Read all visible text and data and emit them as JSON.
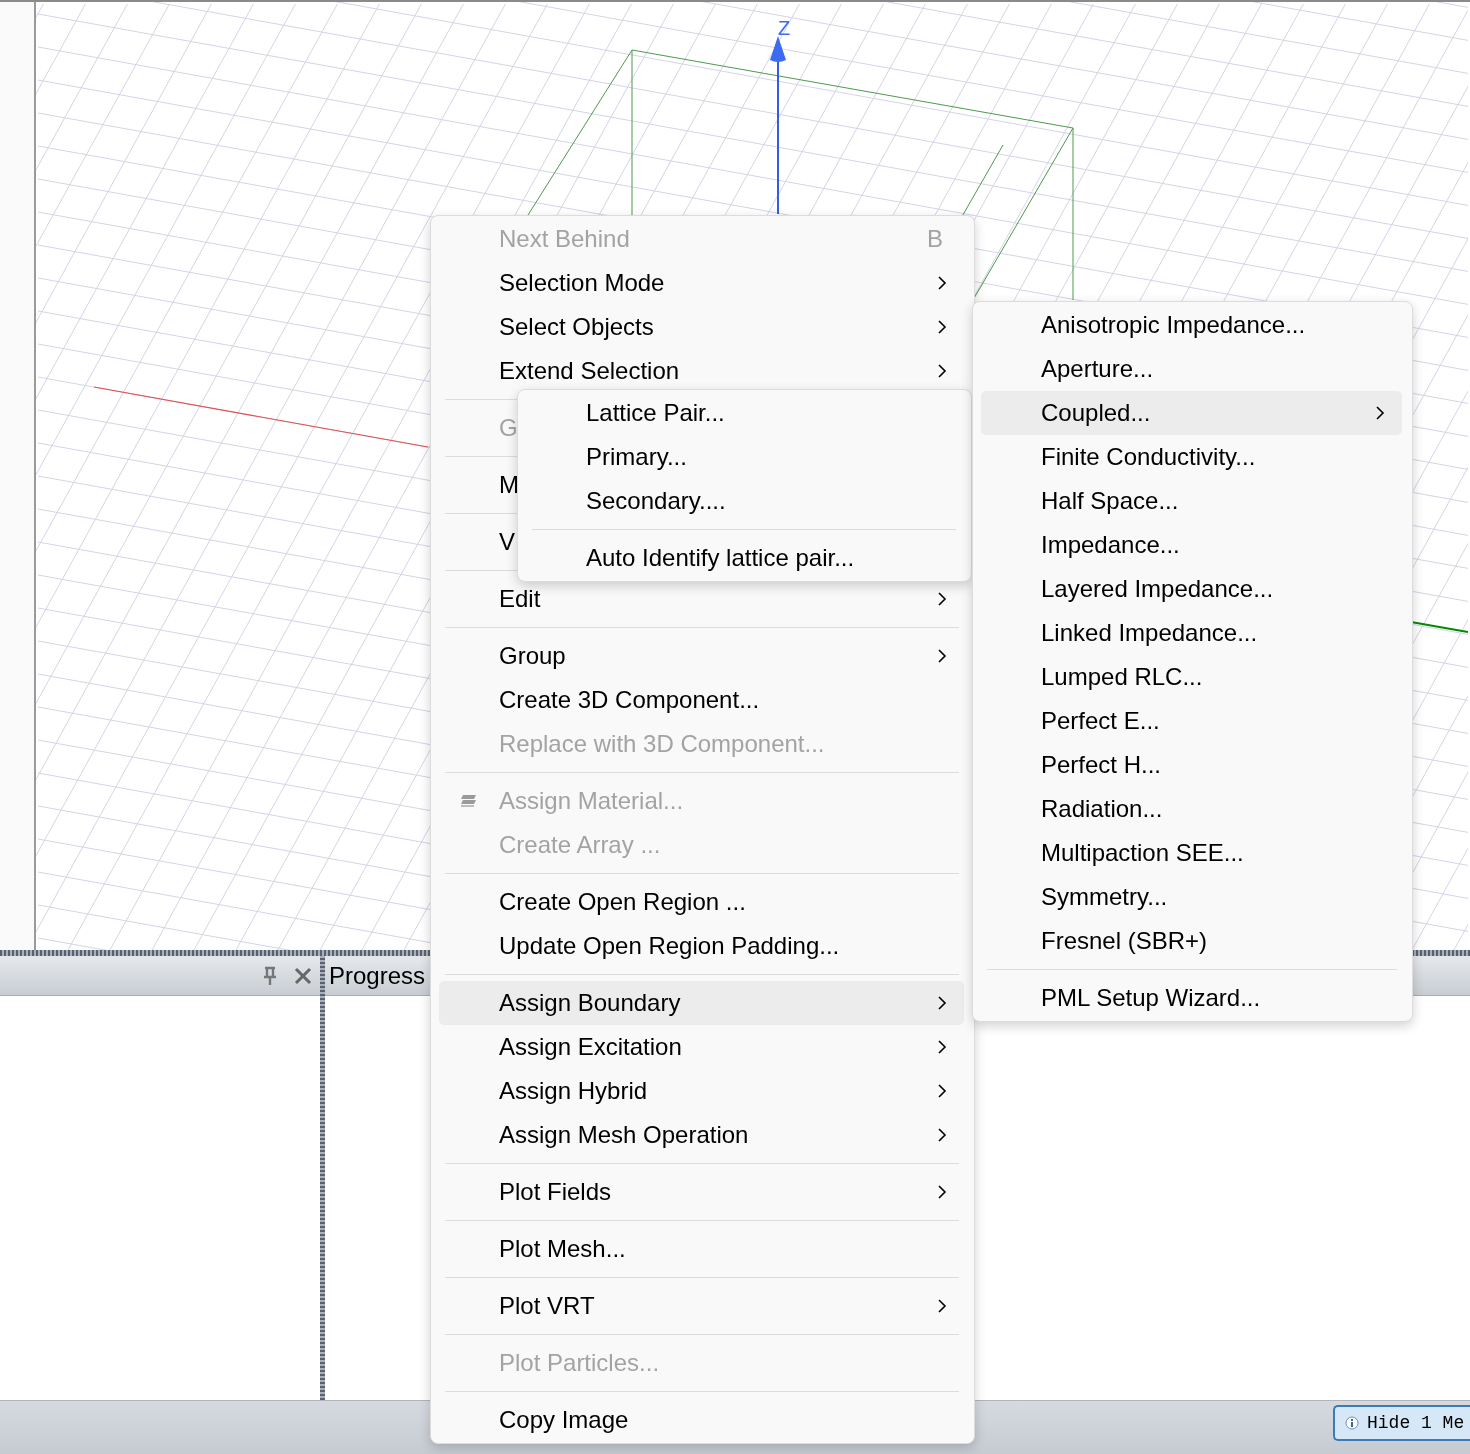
{
  "viewport": {
    "axis_label": "Z"
  },
  "progress_panel": {
    "title": "Progress"
  },
  "status_bar": {
    "message_button": "Hide 1 Me"
  },
  "context_menu": {
    "items": [
      {
        "kind": "item",
        "label": "Next Behind",
        "shortcut": "B",
        "disabled": true,
        "submenu": false,
        "selected": false
      },
      {
        "kind": "item",
        "label": "Selection Mode",
        "disabled": false,
        "submenu": true,
        "selected": false
      },
      {
        "kind": "item",
        "label": "Select Objects",
        "disabled": false,
        "submenu": true,
        "selected": false
      },
      {
        "kind": "item",
        "label": "Extend Selection",
        "disabled": false,
        "submenu": true,
        "selected": false
      },
      {
        "kind": "separator"
      },
      {
        "kind": "item",
        "label": "G",
        "disabled": true,
        "submenu": false,
        "selected": false
      },
      {
        "kind": "separator"
      },
      {
        "kind": "item",
        "label": "M",
        "disabled": false,
        "submenu": false,
        "selected": false
      },
      {
        "kind": "separator"
      },
      {
        "kind": "item",
        "label": "V",
        "disabled": false,
        "submenu": false,
        "selected": false
      },
      {
        "kind": "separator"
      },
      {
        "kind": "item",
        "label": "Edit",
        "disabled": false,
        "submenu": true,
        "selected": false
      },
      {
        "kind": "separator"
      },
      {
        "kind": "item",
        "label": "Group",
        "disabled": false,
        "submenu": true,
        "selected": false
      },
      {
        "kind": "item",
        "label": "Create 3D Component...",
        "disabled": false,
        "submenu": false,
        "selected": false
      },
      {
        "kind": "item",
        "label": "Replace with 3D Component...",
        "disabled": true,
        "submenu": false,
        "selected": false
      },
      {
        "kind": "separator"
      },
      {
        "kind": "icon-item",
        "label": "Assign Material...",
        "disabled": true,
        "submenu": false,
        "selected": false
      },
      {
        "kind": "item",
        "label": "Create Array ...",
        "disabled": true,
        "submenu": false,
        "selected": false
      },
      {
        "kind": "separator"
      },
      {
        "kind": "item",
        "label": "Create Open Region ...",
        "disabled": false,
        "submenu": false,
        "selected": false
      },
      {
        "kind": "item",
        "label": "Update Open Region Padding...",
        "disabled": false,
        "submenu": false,
        "selected": false
      },
      {
        "kind": "separator"
      },
      {
        "kind": "item",
        "label": "Assign Boundary",
        "disabled": false,
        "submenu": true,
        "selected": true
      },
      {
        "kind": "item",
        "label": "Assign Excitation",
        "disabled": false,
        "submenu": true,
        "selected": false
      },
      {
        "kind": "item",
        "label": "Assign Hybrid",
        "disabled": false,
        "submenu": true,
        "selected": false
      },
      {
        "kind": "item",
        "label": "Assign Mesh Operation",
        "disabled": false,
        "submenu": true,
        "selected": false
      },
      {
        "kind": "separator"
      },
      {
        "kind": "item",
        "label": "Plot Fields",
        "disabled": false,
        "submenu": true,
        "selected": false
      },
      {
        "kind": "separator"
      },
      {
        "kind": "item",
        "label": "Plot Mesh...",
        "disabled": false,
        "submenu": false,
        "selected": false
      },
      {
        "kind": "separator"
      },
      {
        "kind": "item",
        "label": "Plot VRT",
        "disabled": false,
        "submenu": true,
        "selected": false
      },
      {
        "kind": "separator"
      },
      {
        "kind": "item",
        "label": "Plot Particles...",
        "disabled": true,
        "submenu": false,
        "selected": false
      },
      {
        "kind": "separator"
      },
      {
        "kind": "item",
        "label": "Copy Image",
        "disabled": false,
        "submenu": false,
        "selected": false
      }
    ]
  },
  "lattice_submenu": {
    "items": [
      {
        "kind": "item",
        "label": "Lattice Pair...",
        "disabled": false,
        "submenu": false,
        "selected": false
      },
      {
        "kind": "item",
        "label": "Primary...",
        "disabled": false,
        "submenu": false,
        "selected": false
      },
      {
        "kind": "item",
        "label": "Secondary....",
        "disabled": false,
        "submenu": false,
        "selected": false
      },
      {
        "kind": "separator"
      },
      {
        "kind": "item",
        "label": "Auto Identify lattice pair...",
        "disabled": false,
        "submenu": false,
        "selected": false
      }
    ]
  },
  "boundary_submenu": {
    "items": [
      {
        "kind": "item",
        "label": "Anisotropic Impedance...",
        "disabled": false,
        "submenu": false,
        "selected": false
      },
      {
        "kind": "item",
        "label": "Aperture...",
        "disabled": false,
        "submenu": false,
        "selected": false
      },
      {
        "kind": "item",
        "label": "Coupled...",
        "disabled": false,
        "submenu": true,
        "selected": true
      },
      {
        "kind": "item",
        "label": "Finite Conductivity...",
        "disabled": false,
        "submenu": false,
        "selected": false
      },
      {
        "kind": "item",
        "label": "Half Space...",
        "disabled": false,
        "submenu": false,
        "selected": false
      },
      {
        "kind": "item",
        "label": "Impedance...",
        "disabled": false,
        "submenu": false,
        "selected": false
      },
      {
        "kind": "item",
        "label": "Layered Impedance...",
        "disabled": false,
        "submenu": false,
        "selected": false
      },
      {
        "kind": "item",
        "label": "Linked Impedance...",
        "disabled": false,
        "submenu": false,
        "selected": false
      },
      {
        "kind": "item",
        "label": "Lumped RLC...",
        "disabled": false,
        "submenu": false,
        "selected": false
      },
      {
        "kind": "item",
        "label": "Perfect E...",
        "disabled": false,
        "submenu": false,
        "selected": false
      },
      {
        "kind": "item",
        "label": "Perfect H...",
        "disabled": false,
        "submenu": false,
        "selected": false
      },
      {
        "kind": "item",
        "label": "Radiation...",
        "disabled": false,
        "submenu": false,
        "selected": false
      },
      {
        "kind": "item",
        "label": "Multipaction SEE...",
        "disabled": false,
        "submenu": false,
        "selected": false
      },
      {
        "kind": "item",
        "label": "Symmetry...",
        "disabled": false,
        "submenu": false,
        "selected": false
      },
      {
        "kind": "item",
        "label": "Fresnel (SBR+)",
        "disabled": false,
        "submenu": false,
        "selected": false
      },
      {
        "kind": "separator"
      },
      {
        "kind": "item",
        "label": "PML Setup Wizard...",
        "disabled": false,
        "submenu": false,
        "selected": false
      }
    ]
  }
}
